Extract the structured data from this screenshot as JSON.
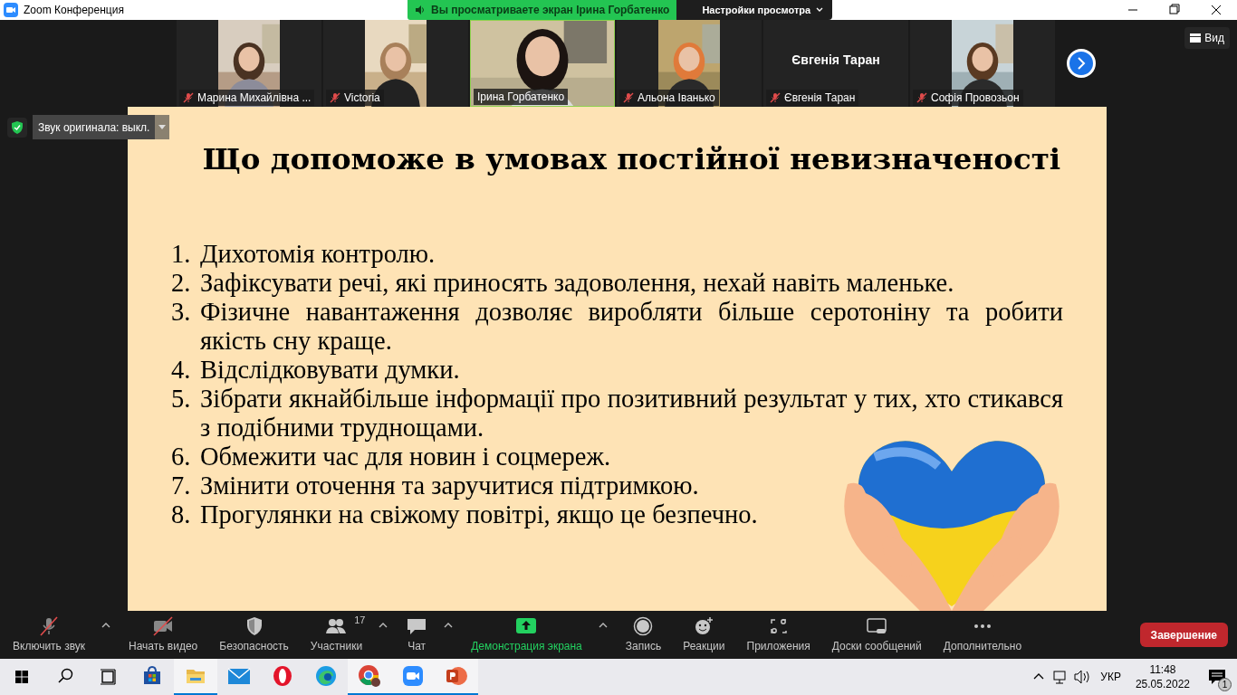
{
  "window": {
    "title": "Zoom Конференция"
  },
  "share_banner": {
    "text": "Вы просматриваете экран Ірина Горбатенко",
    "view_options": "Настройки просмотра"
  },
  "participants": [
    {
      "name": "Марина Михайлівна ...",
      "muted": true,
      "video": true,
      "speaking": false
    },
    {
      "name": "Victoria",
      "muted": true,
      "video": true,
      "speaking": false
    },
    {
      "name": "Ірина Горбатенко",
      "muted": false,
      "video": true,
      "speaking": true
    },
    {
      "name": "Альона Іванько",
      "muted": true,
      "video": true,
      "speaking": false
    },
    {
      "name": "Євгенія Таран",
      "name_large": "Євгенія Таран",
      "muted": true,
      "video": false,
      "speaking": false
    },
    {
      "name": "Софія Провозьон",
      "muted": true,
      "video": true,
      "speaking": false
    }
  ],
  "view_button": "Вид",
  "original_sound": "Звук оригинала: выкл.",
  "slide": {
    "title": "Що допоможе в умовах постійної невизначеності",
    "items": [
      {
        "number": "1.",
        "text": "Дихотомія контролю."
      },
      {
        "number": "2.",
        "text": "Зафіксувати речі, які приносять задоволення, нехай навіть маленьке."
      },
      {
        "number": "3.",
        "text": "Фізичне навантаження дозволяє виробляти більше серотоніну та робити якість сну краще."
      },
      {
        "number": "4.",
        "text": "Відслідковувати думки."
      },
      {
        "number": "5.",
        "text": "Зібрати якнайбільше інформації про позитивний результат у тих, хто стикався з подібними труднощами."
      },
      {
        "number": "6.",
        "text": "Обмежити час для новин і соцмереж."
      },
      {
        "number": "7.",
        "text": "Змінити оточення та заручитися підтримкою."
      },
      {
        "number": "8.",
        "text": "Прогулянки на свіжому повітрі, якщо це безпечно."
      }
    ]
  },
  "toolbar": [
    {
      "kind": "mic",
      "label": "Включить звук",
      "caret": true,
      "active": false
    },
    {
      "kind": "video",
      "label": "Начать видео",
      "caret": false,
      "active": false
    },
    {
      "kind": "security",
      "label": "Безопасность",
      "caret": false,
      "active": false
    },
    {
      "kind": "participants",
      "label": "Участники",
      "count": "17",
      "caret": true,
      "active": false
    },
    {
      "kind": "chat",
      "label": "Чат",
      "caret": true,
      "active": false
    },
    {
      "kind": "share",
      "label": "Демонстрация экрана",
      "caret": true,
      "active": true
    },
    {
      "kind": "record",
      "label": "Запись",
      "caret": false,
      "active": false
    },
    {
      "kind": "reactions",
      "label": "Реакции",
      "caret": false,
      "active": false
    },
    {
      "kind": "apps",
      "label": "Приложения",
      "caret": false,
      "active": false
    },
    {
      "kind": "whiteboard",
      "label": "Доски сообщений",
      "caret": false,
      "active": false
    },
    {
      "kind": "more",
      "label": "Дополнительно",
      "caret": false,
      "active": false
    }
  ],
  "end_button": "Завершение",
  "taskbar": {
    "apps": [
      {
        "kind": "store",
        "running": false
      },
      {
        "kind": "explorer",
        "running": true
      },
      {
        "kind": "mail",
        "running": false
      },
      {
        "kind": "opera",
        "running": false
      },
      {
        "kind": "edge",
        "running": false
      },
      {
        "kind": "chrome",
        "running": true
      },
      {
        "kind": "zoom",
        "running": true
      },
      {
        "kind": "powerpoint",
        "running": true
      }
    ],
    "language": "УКР",
    "time": "11:48",
    "date": "25.05.2022",
    "notifications": "1"
  }
}
